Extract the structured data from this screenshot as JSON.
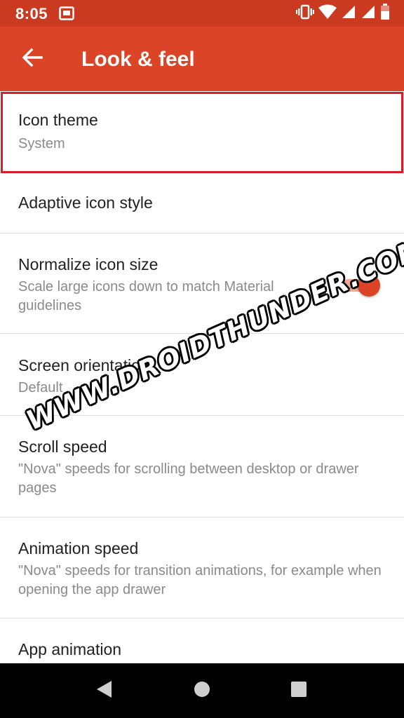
{
  "status_bar": {
    "time": "8:05",
    "left_icon": "screenshot-icon",
    "right_icons": [
      "vibrate-icon",
      "wifi-icon",
      "signal-icon",
      "signal-icon",
      "battery-icon"
    ]
  },
  "app_bar": {
    "title": "Look & feel",
    "back_icon": "arrow-back-icon"
  },
  "settings": {
    "icon_theme": {
      "title": "Icon theme",
      "subtitle": "System"
    },
    "adaptive_icon_style": {
      "title": "Adaptive icon style"
    },
    "normalize_icon_size": {
      "title": "Normalize icon size",
      "subtitle": "Scale large icons down to match Material guidelines",
      "enabled": true
    },
    "screen_orientation": {
      "title": "Screen orientation",
      "subtitle": "Default"
    },
    "scroll_speed": {
      "title": "Scroll speed",
      "subtitle": "\"Nova\" speeds for scrolling between desktop or drawer pages"
    },
    "animation_speed": {
      "title": "Animation speed",
      "subtitle": "\"Nova\" speeds for transition animations, for example when opening the app drawer"
    },
    "app_animation": {
      "title": "App animation"
    }
  },
  "watermark": "WWW.DROIDTHUNDER.COM",
  "nav_bar": {
    "back": "nav-back-icon",
    "home": "nav-home-icon",
    "recents": "nav-recents-icon"
  },
  "colors": {
    "status_bar": "#c93a20",
    "app_bar": "#db4426",
    "accent": "#db4426",
    "highlight_border": "#d81e2b"
  }
}
